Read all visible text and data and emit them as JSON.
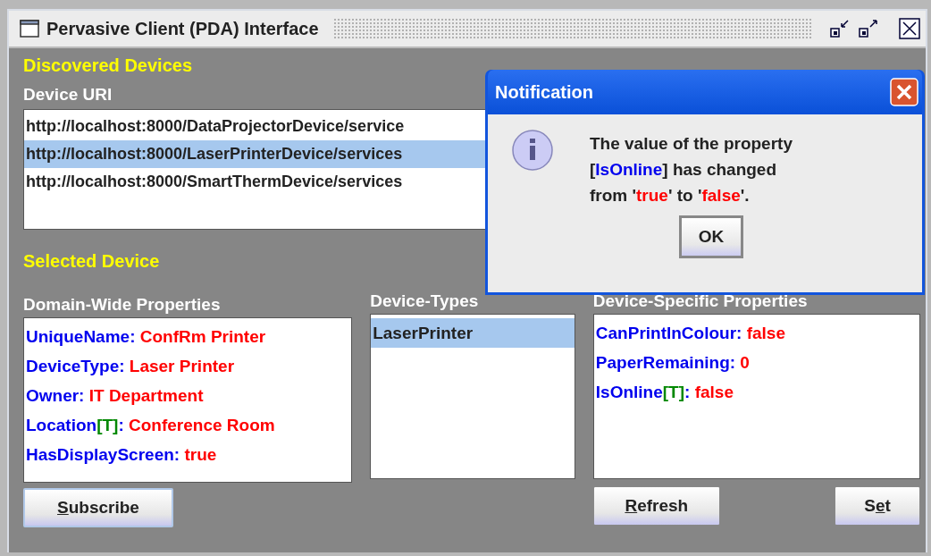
{
  "window": {
    "title": "Pervasive Client (PDA) Interface"
  },
  "discovered_devices": {
    "heading": "Discovered Devices",
    "column_label": "Device URI",
    "items": [
      {
        "text": "http://localhost:8000/DataProjectorDevice/service",
        "selected": false
      },
      {
        "text": "http://localhost:8000/LaserPrinterDevice/services",
        "selected": true
      },
      {
        "text": "http://localhost:8000/SmartThermDevice/services",
        "selected": false
      }
    ]
  },
  "selected_device": {
    "heading": "Selected Device",
    "domain_wide_properties": {
      "label": "Domain-Wide Properties",
      "rows": [
        {
          "segments": [
            {
              "kind": "name",
              "text": "UniqueName:"
            },
            {
              "kind": "value",
              "text": " ConfRm Printer"
            }
          ]
        },
        {
          "segments": [
            {
              "kind": "name",
              "text": "DeviceType:"
            },
            {
              "kind": "value",
              "text": " Laser Printer"
            }
          ]
        },
        {
          "segments": [
            {
              "kind": "name",
              "text": "Owner:"
            },
            {
              "kind": "value",
              "text": " IT Department"
            }
          ]
        },
        {
          "segments": [
            {
              "kind": "name",
              "text": "Location"
            },
            {
              "kind": "tag",
              "text": "[T]"
            },
            {
              "kind": "name",
              "text": ":"
            },
            {
              "kind": "value",
              "text": " Conference Room"
            }
          ]
        },
        {
          "segments": [
            {
              "kind": "name",
              "text": "HasDisplayScreen:"
            },
            {
              "kind": "value",
              "text": " true"
            }
          ]
        }
      ]
    },
    "device_types": {
      "label": "Device-Types",
      "items": [
        {
          "text": "LaserPrinter",
          "selected": true
        }
      ]
    },
    "device_specific_properties": {
      "label": "Device-Specific Properties",
      "rows": [
        {
          "segments": [
            {
              "kind": "name",
              "text": "CanPrintInColour:"
            },
            {
              "kind": "value",
              "text": " false"
            }
          ]
        },
        {
          "segments": [
            {
              "kind": "name",
              "text": "PaperRemaining:"
            },
            {
              "kind": "value",
              "text": " 0"
            }
          ]
        },
        {
          "segments": [
            {
              "kind": "name",
              "text": "IsOnline"
            },
            {
              "kind": "tag",
              "text": "[T]"
            },
            {
              "kind": "name",
              "text": ":"
            },
            {
              "kind": "value",
              "text": " false"
            }
          ]
        }
      ]
    },
    "buttons": {
      "subscribe": [
        {
          "text": "S",
          "underline": true
        },
        {
          "text": "ubscribe",
          "underline": false
        }
      ],
      "refresh": [
        {
          "text": "R",
          "underline": true
        },
        {
          "text": "efresh",
          "underline": false
        }
      ],
      "set": [
        {
          "text": "S",
          "underline": false
        },
        {
          "text": "e",
          "underline": true
        },
        {
          "text": "t",
          "underline": false
        }
      ]
    }
  },
  "notification": {
    "title": "Notification",
    "message": [
      [
        {
          "kind": "plain",
          "text": "The value of the property"
        }
      ],
      [
        {
          "kind": "plain",
          "text": "["
        },
        {
          "kind": "name",
          "text": "IsOnline"
        },
        {
          "kind": "plain",
          "text": "] has changed"
        }
      ],
      [
        {
          "kind": "plain",
          "text": "from '"
        },
        {
          "kind": "value",
          "text": "true"
        },
        {
          "kind": "plain",
          "text": "' to '"
        },
        {
          "kind": "value",
          "text": "false"
        },
        {
          "kind": "plain",
          "text": "'."
        }
      ]
    ],
    "button": "OK"
  }
}
